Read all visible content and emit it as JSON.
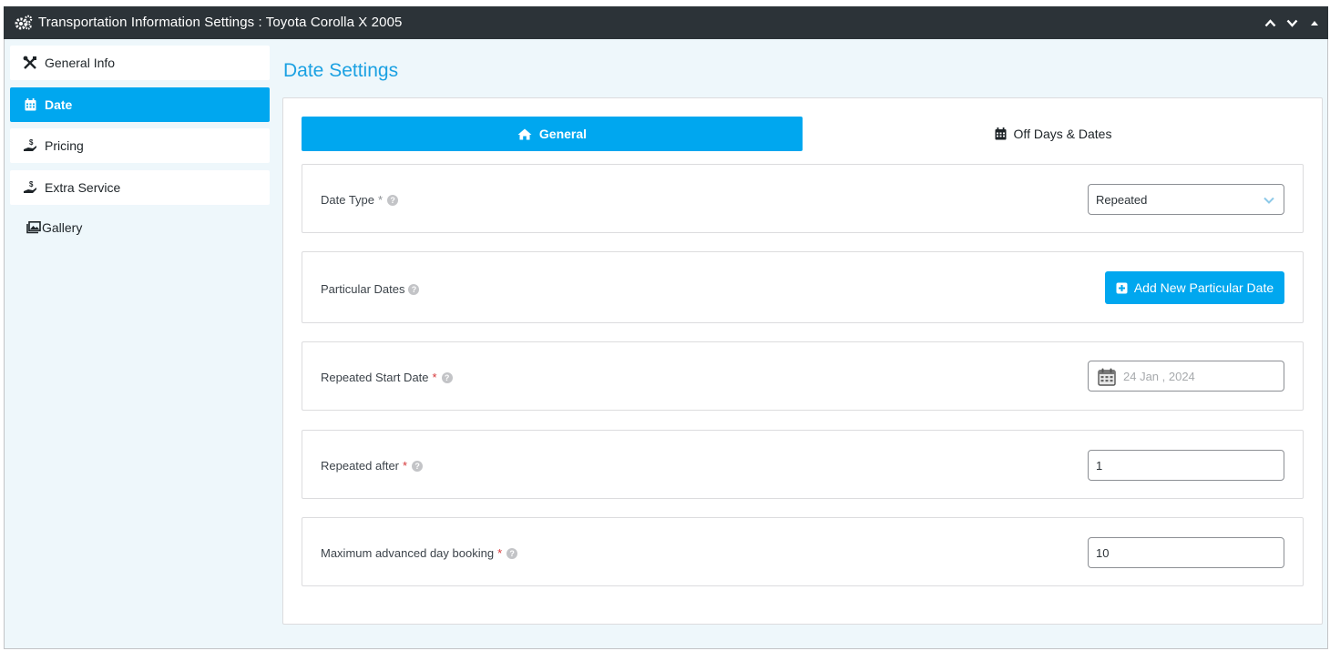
{
  "window": {
    "title": "Transportation Information Settings : Toyota Corolla X 2005",
    "icons": [
      "gear-icon",
      "chevron-up-icon",
      "chevron-down-icon",
      "triangle-up-icon"
    ]
  },
  "sidebar": {
    "items": [
      {
        "label": "General Info",
        "icon": "tools-icon",
        "active": false
      },
      {
        "label": "Date",
        "icon": "calendar-icon",
        "active": true
      },
      {
        "label": "Pricing",
        "icon": "hand-dollar-icon",
        "active": false
      },
      {
        "label": "Extra Service",
        "icon": "hand-dollar-icon",
        "active": false
      },
      {
        "label": "Gallery",
        "icon": "images-icon",
        "active": false
      }
    ]
  },
  "main": {
    "title": "Date Settings",
    "tabs": [
      {
        "label": "General",
        "icon": "home-icon",
        "active": true
      },
      {
        "label": "Off Days & Dates",
        "icon": "calendar-icon",
        "active": false
      }
    ],
    "fields": {
      "date_type": {
        "label": "Date Type",
        "required": "*",
        "value": "Repeated"
      },
      "particular_dates": {
        "label": "Particular Dates",
        "button_label": "Add New Particular Date"
      },
      "repeated_start_date": {
        "label": "Repeated Start Date",
        "required": "*",
        "value": "24 Jan , 2024"
      },
      "repeated_after": {
        "label": "Repeated after",
        "required": "*",
        "value": "1"
      },
      "max_advanced_booking": {
        "label": "Maximum advanced day booking",
        "required": "*",
        "value": "10"
      }
    }
  },
  "colors": {
    "accent": "#00a7ef",
    "titlebar": "#2c3338",
    "heading": "#1ba1e2",
    "required": "#d63638",
    "background": "#eef7fb"
  }
}
